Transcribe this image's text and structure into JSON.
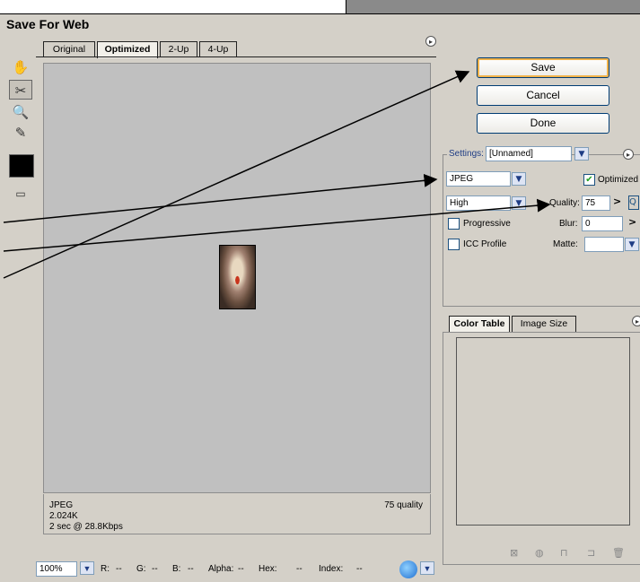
{
  "window": {
    "title": "Save For Web"
  },
  "tabs": [
    {
      "label": "Original"
    },
    {
      "label": "Optimized"
    },
    {
      "label": "2-Up"
    },
    {
      "label": "4-Up"
    }
  ],
  "preview_info": {
    "format": "JPEG",
    "size": "2.024K",
    "time": "2 sec @ 28.8Kbps",
    "quality": "75 quality"
  },
  "status": {
    "zoom": "100%",
    "r_label": "R:",
    "r_value": "--",
    "g_label": "G:",
    "g_value": "--",
    "b_label": "B:",
    "b_value": "--",
    "alpha_label": "Alpha:",
    "alpha_value": "--",
    "hex_label": "Hex:",
    "hex_value": "--",
    "index_label": "Index:",
    "index_value": "--"
  },
  "buttons": {
    "save": "Save",
    "cancel": "Cancel",
    "done": "Done"
  },
  "settings": {
    "label": "Settings:",
    "preset": "[Unnamed]",
    "format": "JPEG",
    "optimized_label": "Optimized",
    "quality_preset": "High",
    "quality_label": "Quality:",
    "quality_value": "75",
    "progressive_label": "Progressive",
    "blur_label": "Blur:",
    "blur_value": "0",
    "icc_label": "ICC Profile",
    "matte_label": "Matte:"
  },
  "color_panel": {
    "tab_color_table": "Color Table",
    "tab_image_size": "Image Size"
  },
  "colors": {
    "button_border": "#003c74",
    "default_glow": "#f0b24a",
    "preview_bg": "#c0c0c0",
    "check": "#21a121"
  }
}
